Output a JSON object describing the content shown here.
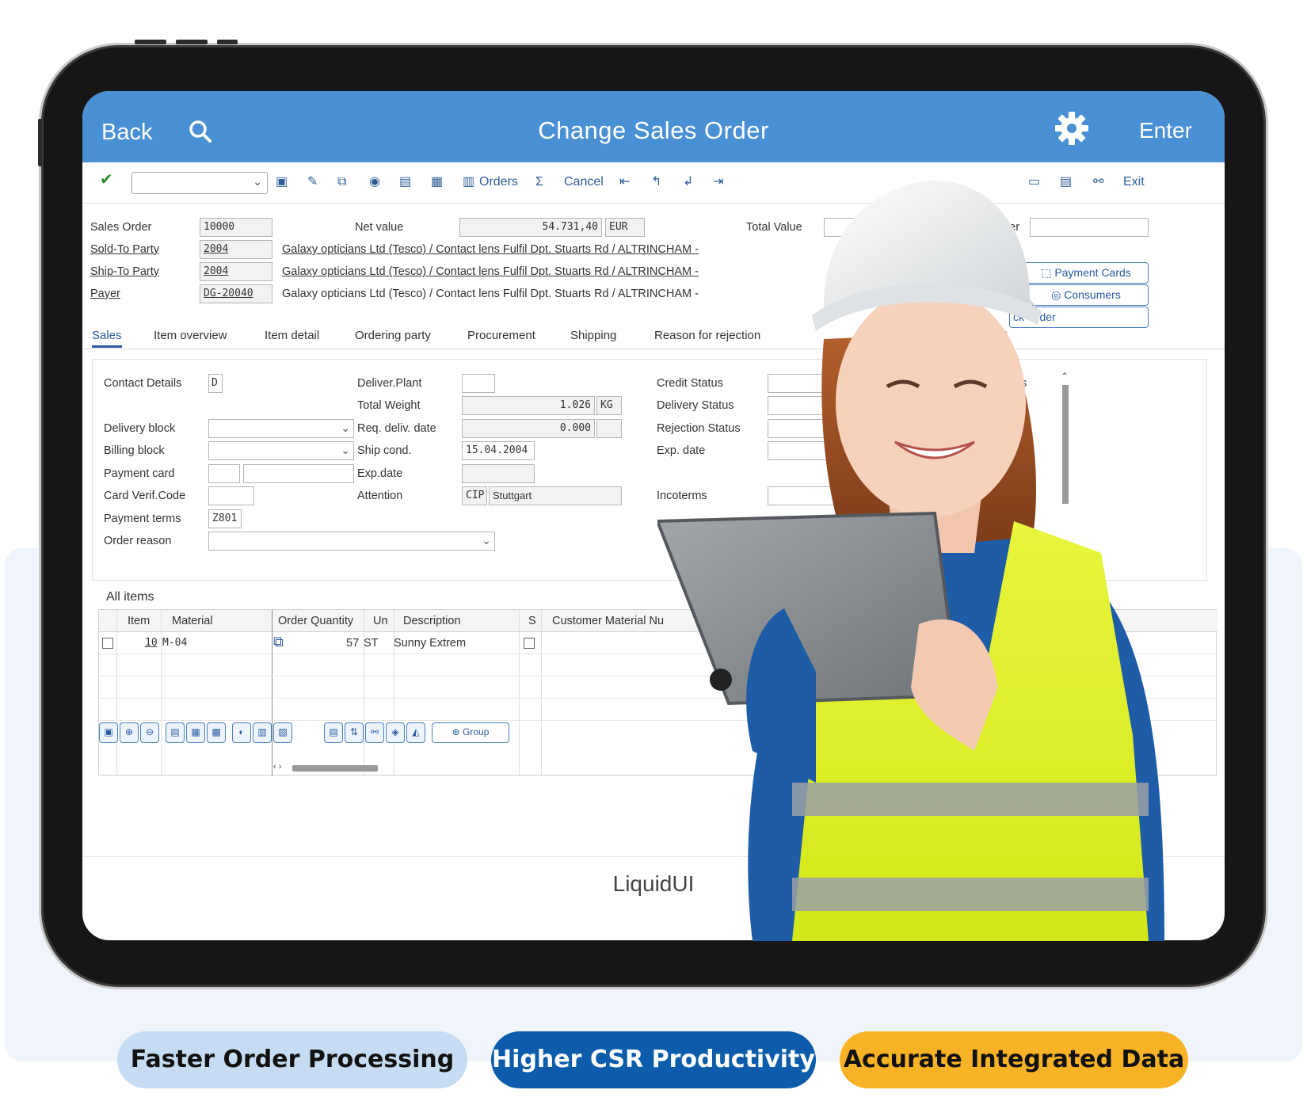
{
  "titlebar": {
    "back": "Back",
    "title": "Change Sales Order",
    "enter": "Enter"
  },
  "toolbar": {
    "orders": "Orders",
    "sigma": "Σ",
    "cancel": "Cancel",
    "exit": "Exit"
  },
  "header": {
    "sales_order_label": "Sales Order",
    "sales_order_value": "10000",
    "net_value_label": "Net value",
    "net_value": "54.731,40",
    "currency": "EUR",
    "total_value_label": "Total Value",
    "number_label": "mber",
    "sold_to_label": "Sold-To Party",
    "sold_to_value": "2004",
    "ship_to_label": "Ship-To Party",
    "ship_to_value": "2004",
    "payer_label": "Payer",
    "payer_value": "DG-20040",
    "address_sold": "Galaxy opticians Ltd (Tesco) / Contact lens Fulfil Dpt. Stuarts Rd / ALTRINCHAM -",
    "address_ship": "Galaxy opticians Ltd (Tesco) / Contact lens Fulfil Dpt. Stuarts Rd / ALTRINCHAM -",
    "address_payer": "Galaxy opticians Ltd (Tesco) / Contact lens Fulfil Dpt. Stuarts Rd / ALTRINCHAM -",
    "payment_cards": "Payment Cards",
    "consumers": "Consumers",
    "block_order": "ck Order"
  },
  "tabs": [
    "Sales",
    "Item overview",
    "Item detail",
    "Ordering party",
    "Procurement",
    "Shipping",
    "Reason for rejection"
  ],
  "sales": {
    "contact_details": "Contact Details",
    "contact_value": "D",
    "delivery_block": "Delivery block",
    "billing_block": "Billing block",
    "payment_card": "Payment card",
    "card_verif": "Card Verif.Code",
    "payment_terms": "Payment terms",
    "payment_terms_value": "Z801",
    "order_reason": "Order reason",
    "deliver_plant": "Deliver.Plant",
    "total_weight": "Total Weight",
    "total_weight_value": "1.026",
    "weight_unit": "KG",
    "req_deliv": "Req. deliv. date",
    "req_deliv_value": "0.000",
    "ship_cond": "Ship cond.",
    "ship_cond_value": "15.04.2004",
    "exp_date": "Exp.date",
    "attention": "Attention",
    "attention_code": "CIP",
    "attention_value": "Stuttgart",
    "credit_status": "Credit Status",
    "delivery_status": "Delivery Status",
    "rejection_status": "Rejection Status",
    "exp_date2": "Exp. date",
    "incoterms": "Incoterms",
    "clipped_s": "s"
  },
  "items": {
    "title": "All items",
    "columns": [
      "Item",
      "Material",
      "Order Quantity",
      "Un",
      "Description",
      "S",
      "Customer Material Nu"
    ],
    "rows": [
      {
        "item": "10",
        "material": "M-04",
        "qty": "57",
        "unit": "ST",
        "description": "Sunny Extrem"
      }
    ],
    "group": "Group"
  },
  "brand": "LiquidUI",
  "brand_clip": "S",
  "pills": [
    {
      "label": "Faster Order Processing",
      "bg": "#c5dcf2",
      "fg": "#111111"
    },
    {
      "label": "Higher CSR Productivity",
      "bg": "#0d5cab",
      "fg": "#ffffff"
    },
    {
      "label": "Accurate Integrated Data",
      "bg": "#f7b325",
      "fg": "#111111"
    }
  ],
  "colors": {
    "titlebar": "#4a90d4",
    "accent": "#2a5aa0"
  }
}
